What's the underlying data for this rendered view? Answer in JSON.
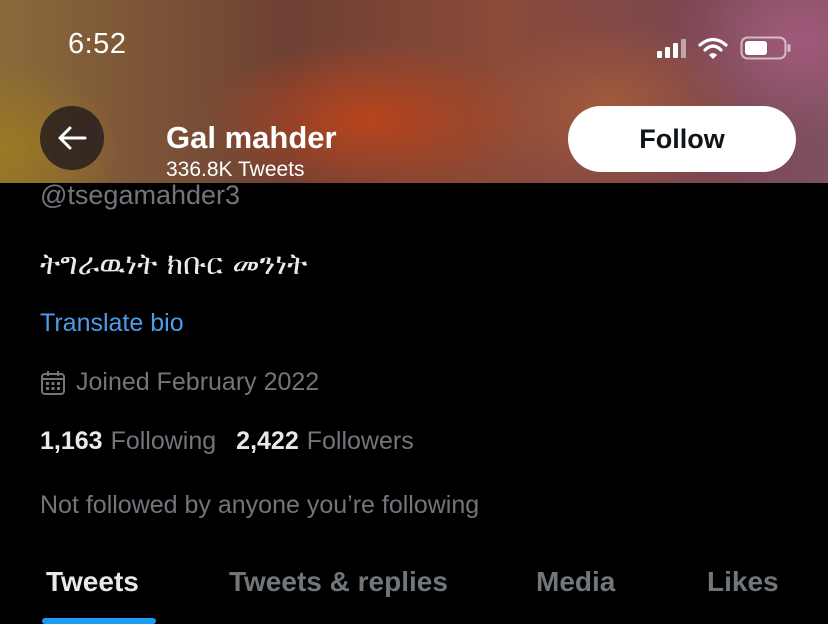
{
  "status_bar": {
    "time": "6:52"
  },
  "header": {
    "name": "Gal mahder",
    "tweet_count": "336.8K Tweets",
    "follow_label": "Follow"
  },
  "profile": {
    "handle": "@tsegamahder3",
    "bio": "ትግራዉነት ክቡር መንነት",
    "translate_label": "Translate bio",
    "joined": "Joined February 2022",
    "following_count": "1,163",
    "following_label": "Following",
    "followers_count": "2,422",
    "followers_label": "Followers",
    "not_followed": "Not followed by anyone you’re following"
  },
  "tabs": [
    {
      "label": "Tweets",
      "active": true
    },
    {
      "label": "Tweets & replies",
      "active": false
    },
    {
      "label": "Media",
      "active": false
    },
    {
      "label": "Likes",
      "active": false
    }
  ],
  "colors": {
    "accent": "#1d9bf0",
    "link": "#4a9de8",
    "muted": "#71767b"
  }
}
